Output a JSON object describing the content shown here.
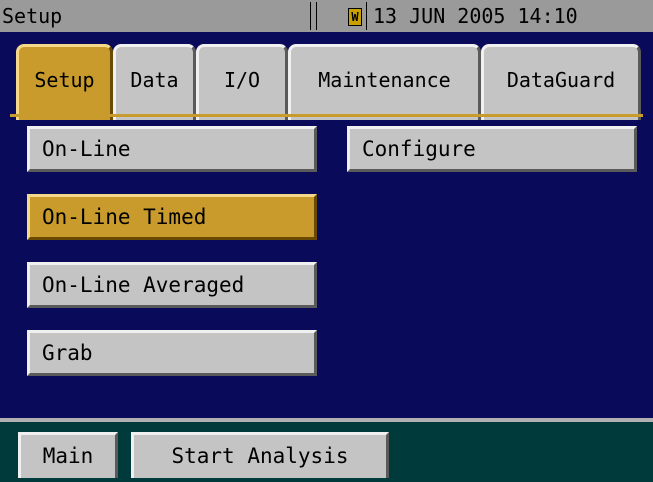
{
  "titlebar": {
    "title": "Setup",
    "alarm_glyph": "W",
    "alarm_color": "#c8a000",
    "datetime": "13 JUN 2005 14:10"
  },
  "tabs": [
    {
      "label": "Setup",
      "active": true
    },
    {
      "label": "Data",
      "active": false
    },
    {
      "label": "I/O",
      "active": false
    },
    {
      "label": "Maintenance",
      "active": false
    },
    {
      "label": "DataGuard",
      "active": false
    }
  ],
  "buttons": {
    "online": "On-Line",
    "online_timed": "On-Line Timed",
    "online_averaged": "On-Line Averaged",
    "grab": "Grab",
    "configure": "Configure"
  },
  "selected_button": "On-Line Timed",
  "bottom": {
    "main": "Main",
    "start_analysis": "Start Analysis"
  },
  "colors": {
    "panel_bg": "#0a0a5a",
    "accent": "#c89b2c",
    "button_gray": "#c4c4c4",
    "bottom_bg": "#003a3a"
  }
}
